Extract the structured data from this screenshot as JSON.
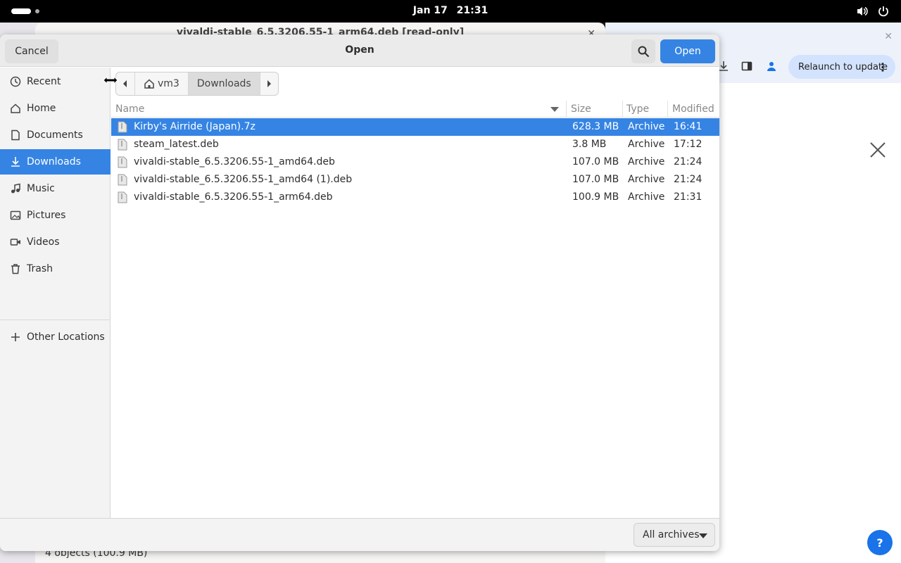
{
  "topbar": {
    "date": "Jan 17",
    "time": "21:31",
    "icons": [
      "volume-icon",
      "power-icon"
    ]
  },
  "background": {
    "file_window_title": "vivaldi-stable_6.5.3206.55-1_arm64.deb [read-only]",
    "file_window_status": "4 objects (100.9 MB)",
    "browser_relaunch_label": "Relaunch to update"
  },
  "dialog": {
    "title": "Open",
    "cancel_label": "Cancel",
    "open_label": "Open",
    "sidebar": {
      "items": [
        {
          "label": "Recent",
          "icon": "clock-icon"
        },
        {
          "label": "Home",
          "icon": "home-icon"
        },
        {
          "label": "Documents",
          "icon": "document-icon"
        },
        {
          "label": "Downloads",
          "icon": "download-icon",
          "active": true
        },
        {
          "label": "Music",
          "icon": "music-icon"
        },
        {
          "label": "Pictures",
          "icon": "picture-icon"
        },
        {
          "label": "Videos",
          "icon": "video-icon"
        },
        {
          "label": "Trash",
          "icon": "trash-icon"
        }
      ],
      "other_locations": "Other Locations"
    },
    "pathbar": {
      "segments": [
        "vm3",
        "Downloads"
      ]
    },
    "columns": {
      "name": "Name",
      "size": "Size",
      "type": "Type",
      "modified": "Modified"
    },
    "files": [
      {
        "name": "Kirby's Airride (Japan).7z",
        "size": "628.3 MB",
        "type": "Archive",
        "modified": "16:41",
        "selected": true
      },
      {
        "name": "steam_latest.deb",
        "size": "3.8 MB",
        "type": "Archive",
        "modified": "17:12"
      },
      {
        "name": "vivaldi-stable_6.5.3206.55-1_amd64.deb",
        "size": "107.0 MB",
        "type": "Archive",
        "modified": "21:24"
      },
      {
        "name": "vivaldi-stable_6.5.3206.55-1_amd64 (1).deb",
        "size": "107.0 MB",
        "type": "Archive",
        "modified": "21:24"
      },
      {
        "name": "vivaldi-stable_6.5.3206.55-1_arm64.deb",
        "size": "100.9 MB",
        "type": "Archive",
        "modified": "21:31"
      }
    ],
    "filter_label": "All archives"
  },
  "help_label": "?",
  "colors": {
    "accent": "#3584e4",
    "topbar": "#000000",
    "relaunch_bg": "#d3e3fd",
    "help_bg": "#1a73e8"
  }
}
